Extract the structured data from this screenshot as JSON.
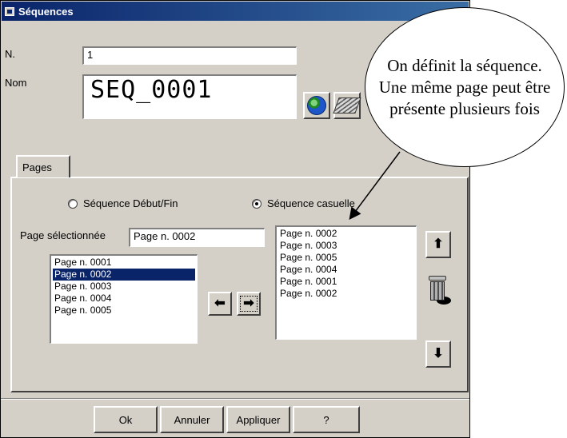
{
  "window": {
    "title": "Séquences"
  },
  "form": {
    "n_label": "N.",
    "n_value": "1",
    "nom_label": "Nom",
    "nom_value": "SEQ_0001"
  },
  "tabs": [
    {
      "label": "Pages"
    }
  ],
  "radios": {
    "debut_fin": "Séquence Début/Fin",
    "casuelle": "Séquence casuelle",
    "selected": "casuelle"
  },
  "selection": {
    "label": "Page sélectionnée",
    "value": "Page n. 0002"
  },
  "available_pages": {
    "items": [
      "Page n. 0001",
      "Page n. 0002",
      "Page n. 0003",
      "Page n. 0004",
      "Page n. 0005"
    ],
    "selected_index": 1
  },
  "sequence_pages": {
    "items": [
      "Page n. 0002",
      "Page n. 0003",
      "Page n. 0005",
      "Page n. 0004",
      "Page n. 0001",
      "Page n. 0002"
    ]
  },
  "icons": {
    "globe": "globe-icon",
    "eraser": "eraser-icon",
    "left": "arrow-left-icon",
    "right": "arrow-right-icon",
    "up": "arrow-up-icon",
    "trash": "trash-icon",
    "down": "arrow-down-icon"
  },
  "buttons": {
    "ok": "Ok",
    "annuler": "Annuler",
    "appliquer": "Appliquer",
    "help": "?"
  },
  "callout": {
    "text": "On définit la séquence. Une même page peut être présente plusieurs fois"
  },
  "colors": {
    "titlebar": "#0a246a",
    "selection": "#0a246a",
    "face": "#d4d0c8"
  }
}
